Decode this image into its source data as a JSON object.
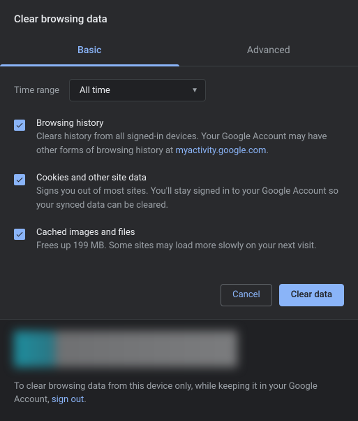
{
  "dialog": {
    "title": "Clear browsing data",
    "tabs": {
      "basic": "Basic",
      "advanced": "Advanced"
    },
    "time_range": {
      "label": "Time range",
      "value": "All time"
    },
    "options": {
      "history": {
        "title": "Browsing history",
        "desc_a": "Clears history from all signed-in devices. Your Google Account may have other forms of browsing history at ",
        "link": "myactivity.google.com",
        "desc_b": "."
      },
      "cookies": {
        "title": "Cookies and other site data",
        "desc": "Signs you out of most sites. You'll stay signed in to your Google Account so your synced data can be cleared."
      },
      "cache": {
        "title": "Cached images and files",
        "desc": "Frees up 199 MB. Some sites may load more slowly on your next visit."
      }
    },
    "buttons": {
      "cancel": "Cancel",
      "clear": "Clear data"
    },
    "footer": {
      "text_a": "To clear browsing data from this device only, while keeping it in your Google Account, ",
      "link": "sign out",
      "text_b": "."
    }
  }
}
